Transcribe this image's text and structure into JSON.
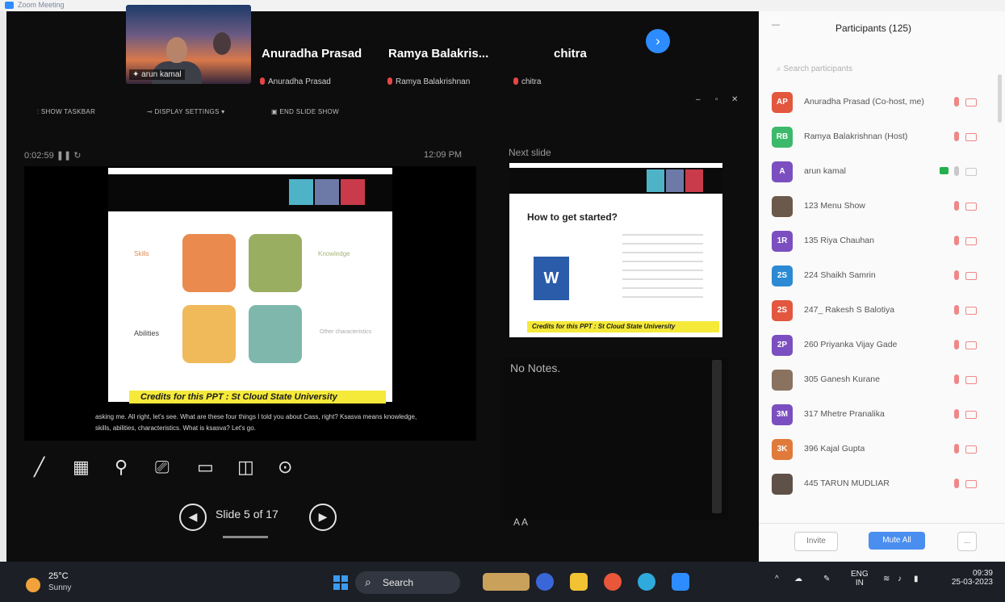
{
  "window": {
    "title": "Zoom Meeting"
  },
  "video_strip": {
    "self_tag": "arun kamal",
    "tiles": [
      {
        "big_name": "Anuradha Prasad",
        "small_name": "Anuradha Prasad"
      },
      {
        "big_name": "Ramya  Balakris...",
        "small_name": "Ramya Balakrishnan"
      },
      {
        "big_name": "chitra",
        "small_name": "chitra"
      }
    ]
  },
  "controls": {
    "show_taskbar": "SHOW TASKBAR",
    "display_settings": "DISPLAY SETTINGS ▾",
    "end_slide_show": "END SLIDE SHOW"
  },
  "presenter": {
    "timer": "0:02:59",
    "clock": "12:09 PM",
    "next_slide_header": "Next slide",
    "notes": "No Notes.",
    "slide_label": "Slide 5 of 17",
    "font_size_controls": "A  A"
  },
  "current_slide": {
    "left_labels": [
      "Skills",
      "Abilities"
    ],
    "right_labels": [
      "Knowledge",
      "Other characteristics"
    ],
    "credits": "Credits for this PPT : St Cloud State University",
    "subtitle": "asking me. All right, let's see. What are these four things I told you about Cass, right? Ksasva means knowledge, skills, abilities, characteristics. What is ksasva? Let's go."
  },
  "next_slide": {
    "title": "How to get started?",
    "credits": "Credits for this PPT : St Cloud State University"
  },
  "participants": {
    "title": "Participants (125)",
    "search_placeholder": "Search participants",
    "list": [
      {
        "initials": "AP",
        "name": "Anuradha Prasad (Co-host, me)",
        "color": "#e3573f"
      },
      {
        "initials": "RB",
        "name": "Ramya Balakrishnan (Host)",
        "color": "#3cb96a"
      },
      {
        "initials": "A",
        "name": "arun kamal",
        "color": "#7b4fc0"
      },
      {
        "initials": "",
        "name": "123 Menu Show",
        "color": "#6b5a4b"
      },
      {
        "initials": "1R",
        "name": "135 Riya Chauhan",
        "color": "#7b4fc0"
      },
      {
        "initials": "2S",
        "name": "224 Shaikh Samrin",
        "color": "#2b8ad3"
      },
      {
        "initials": "2S",
        "name": "247_ Rakesh S Balotiya",
        "color": "#e3573f"
      },
      {
        "initials": "2P",
        "name": "260 Priyanka Vijay Gade",
        "color": "#7b4fc0"
      },
      {
        "initials": "",
        "name": "305 Ganesh Kurane",
        "color": "#8a7260"
      },
      {
        "initials": "3M",
        "name": "317 Mhetre Pranalika",
        "color": "#7b4fc0"
      },
      {
        "initials": "3K",
        "name": "396 Kajal Gupta",
        "color": "#e07a3a"
      },
      {
        "initials": "",
        "name": "445 TARUN MUDLIAR",
        "color": "#5f5048"
      }
    ],
    "invite": "Invite",
    "mute_all": "Mute All",
    "more": "..."
  },
  "taskbar": {
    "temperature": "25°C",
    "condition": "Sunny",
    "search": "Search",
    "lang_top": "ENG",
    "lang_bottom": "IN",
    "time": "09:39",
    "date": "25-03-2023"
  }
}
